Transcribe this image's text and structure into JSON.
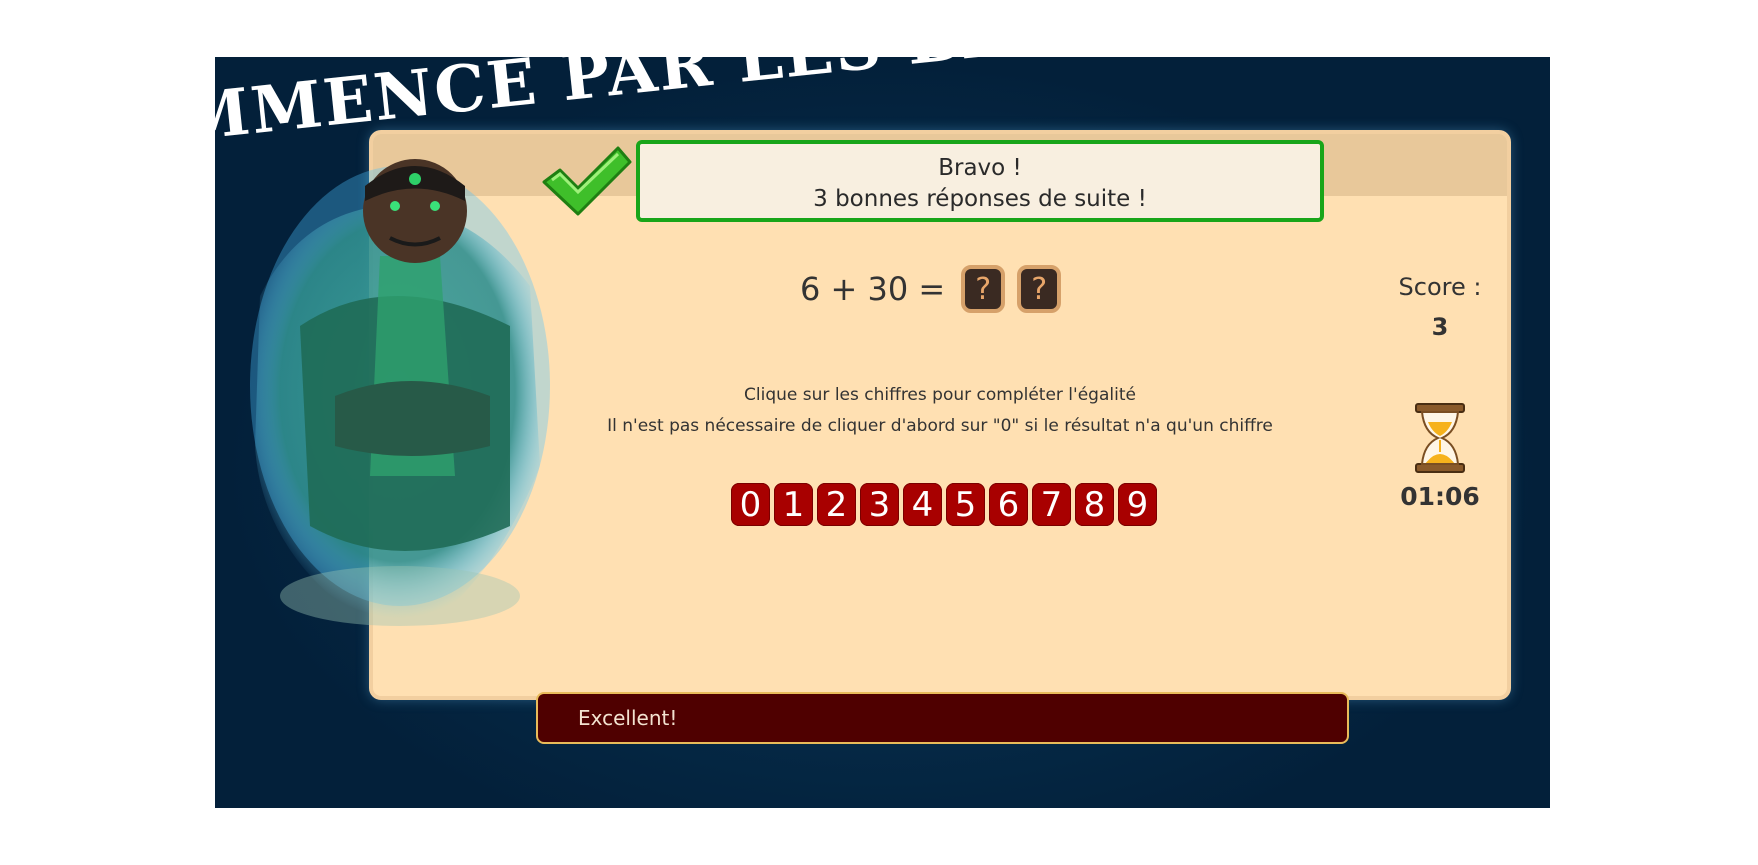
{
  "banner": {
    "text": "MMENCE PAR LES BASES..."
  },
  "message": {
    "line1": "Bravo !",
    "line2": "3 bonnes réponses de suite !"
  },
  "equation": {
    "text": "6 + 30 =",
    "answer_slots": [
      "?",
      "?"
    ]
  },
  "instructions": {
    "line1": "Clique sur les chiffres pour compléter l'égalité",
    "line2": "Il n'est pas nécessaire de cliquer d'abord sur \"0\" si le résultat n'a qu'un chiffre"
  },
  "digits": [
    "0",
    "1",
    "2",
    "3",
    "4",
    "5",
    "6",
    "7",
    "8",
    "9"
  ],
  "score": {
    "label": "Score :",
    "value": "3"
  },
  "timer": {
    "value": "01:06",
    "icon": "hourglass-icon"
  },
  "footer": {
    "text": "Excellent!"
  },
  "colors": {
    "panel": "#ffe0b2",
    "digit_button": "#a80000",
    "success_border": "#19a519",
    "footer_bg": "#4f0000",
    "background": "#03203a"
  }
}
